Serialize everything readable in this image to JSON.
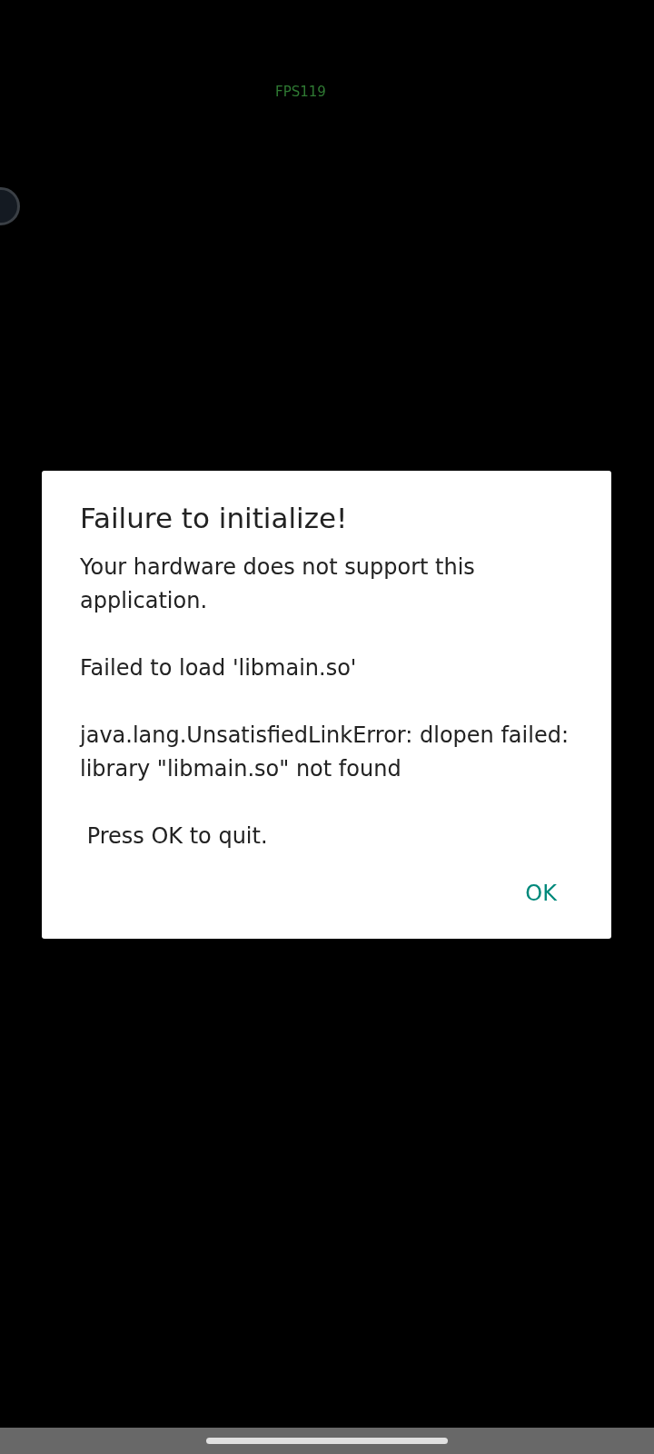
{
  "overlay": {
    "fps": "FPS119"
  },
  "dialog": {
    "title": "Failure to initialize!",
    "paragraphs": [
      "Your hardware does not support this application.",
      "Failed to load 'libmain.so'",
      "java.lang.UnsatisfiedLinkError: dlopen failed: library \"libmain.so\" not found",
      " Press OK to quit."
    ],
    "buttons": [
      "OK"
    ]
  }
}
